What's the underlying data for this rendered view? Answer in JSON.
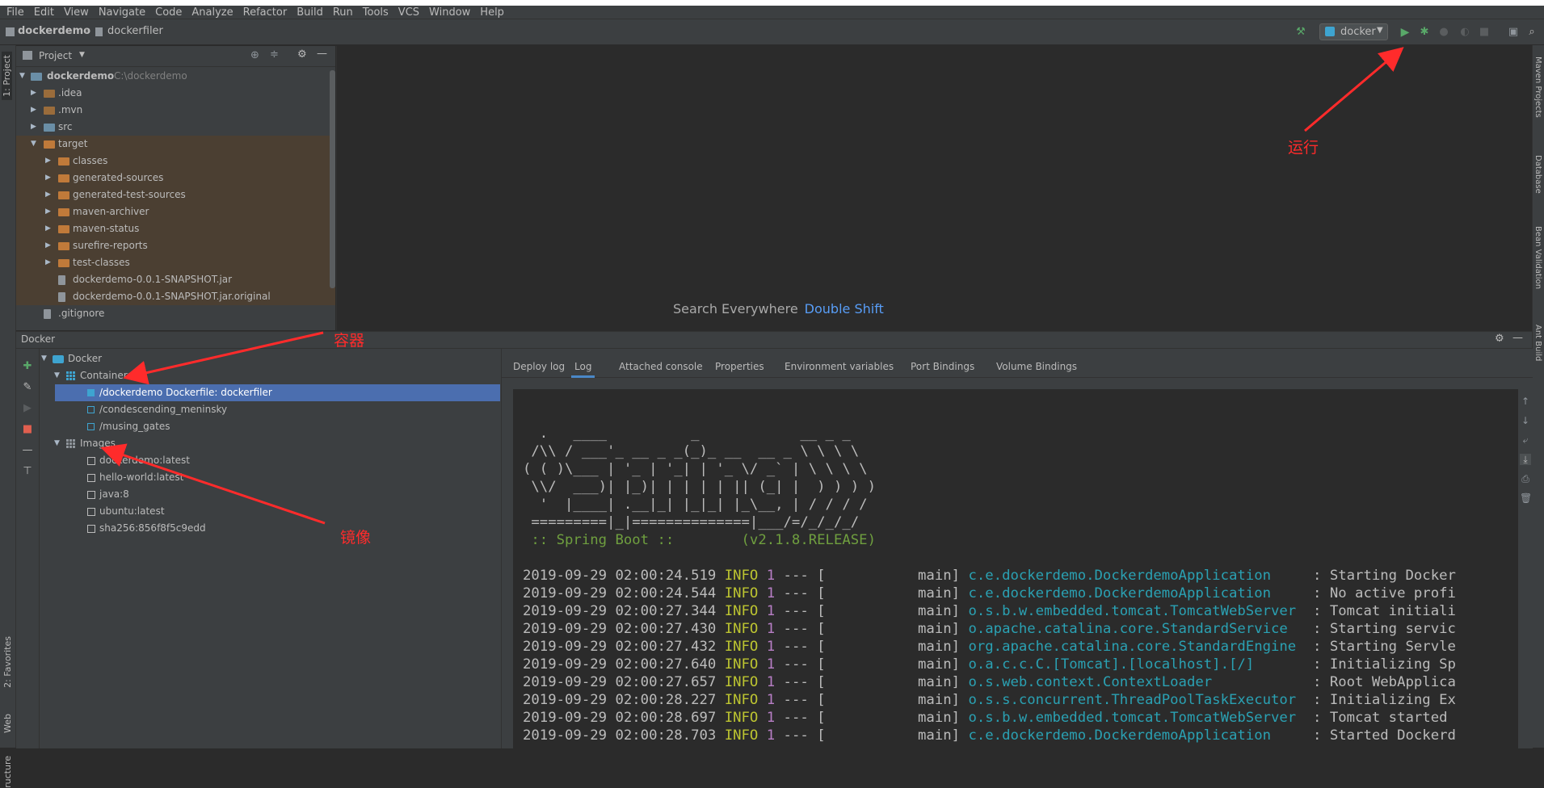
{
  "menu": [
    "File",
    "Edit",
    "View",
    "Navigate",
    "Code",
    "Analyze",
    "Refactor",
    "Build",
    "Run",
    "Tools",
    "VCS",
    "Window",
    "Help"
  ],
  "breadcrumb": {
    "project": "dockerdemo",
    "file": "dockerfiler"
  },
  "run_config": {
    "name": "docker"
  },
  "left_stripe": {
    "project": "1: Project",
    "favorites": "2: Favorites",
    "web": "Web",
    "structure": "ructure"
  },
  "right_stripe": {
    "maven": "Maven Projects",
    "database": "Database",
    "bean": "Bean Validation",
    "ant": "Ant Build"
  },
  "project_panel": {
    "title": "Project",
    "root": {
      "name": "dockerdemo",
      "path": "C:\\dockerdemo"
    },
    "items": [
      {
        "label": ".idea"
      },
      {
        "label": ".mvn"
      },
      {
        "label": "src"
      },
      {
        "label": "target"
      },
      {
        "label": "classes"
      },
      {
        "label": "generated-sources"
      },
      {
        "label": "generated-test-sources"
      },
      {
        "label": "maven-archiver"
      },
      {
        "label": "maven-status"
      },
      {
        "label": "surefire-reports"
      },
      {
        "label": "test-classes"
      },
      {
        "label": "dockerdemo-0.0.1-SNAPSHOT.jar"
      },
      {
        "label": "dockerdemo-0.0.1-SNAPSHOT.jar.original"
      },
      {
        "label": ".gitignore"
      }
    ]
  },
  "editor": {
    "hint_text": "Search Everywhere",
    "hint_key": "Double Shift"
  },
  "docker_panel": {
    "title": "Docker",
    "root": "Docker",
    "containers_label": "Containers",
    "containers": [
      "/dockerdemo Dockerfile: dockerfiler",
      "/condescending_meninsky",
      "/musing_gates"
    ],
    "images_label": "Images",
    "images": [
      "dockerdemo:latest",
      "hello-world:latest",
      "java:8",
      "ubuntu:latest",
      "sha256:856f8f5c9edd"
    ],
    "tabs": [
      "Deploy log",
      "Log",
      "Attached console",
      "Properties",
      "Environment variables",
      "Port Bindings",
      "Volume Bindings"
    ],
    "active_tab": "Log"
  },
  "console": {
    "banner": [
      "  .   ____          _            __ _ _",
      " /\\\\ / ___'_ __ _ _(_)_ __  __ _ \\ \\ \\ \\",
      "( ( )\\___ | '_ | '_| | '_ \\/ _` | \\ \\ \\ \\",
      " \\\\/  ___)| |_)| | | | | || (_| |  ) ) ) )",
      "  '  |____| .__|_| |_|_| |_\\__, | / / / /",
      " =========|_|==============|___/=/_/_/_/"
    ],
    "spring_line": " :: Spring Boot ::        (v2.1.8.RELEASE)",
    "log": [
      {
        "ts": "2019-09-29 02:00:24.519",
        "level": "INFO",
        "pid": "1",
        "sep": " --- [",
        "thread": "           main]",
        "logger": "c.e.dockerdemo.DockerdemoApplication    ",
        "msg": " : Starting Docker"
      },
      {
        "ts": "2019-09-29 02:00:24.544",
        "level": "INFO",
        "pid": "1",
        "sep": " --- [",
        "thread": "           main]",
        "logger": "c.e.dockerdemo.DockerdemoApplication    ",
        "msg": " : No active profi"
      },
      {
        "ts": "2019-09-29 02:00:27.344",
        "level": "INFO",
        "pid": "1",
        "sep": " --- [",
        "thread": "           main]",
        "logger": "o.s.b.w.embedded.tomcat.TomcatWebServer ",
        "msg": " : Tomcat initiali"
      },
      {
        "ts": "2019-09-29 02:00:27.430",
        "level": "INFO",
        "pid": "1",
        "sep": " --- [",
        "thread": "           main]",
        "logger": "o.apache.catalina.core.StandardService  ",
        "msg": " : Starting servic"
      },
      {
        "ts": "2019-09-29 02:00:27.432",
        "level": "INFO",
        "pid": "1",
        "sep": " --- [",
        "thread": "           main]",
        "logger": "org.apache.catalina.core.StandardEngine ",
        "msg": " : Starting Servle"
      },
      {
        "ts": "2019-09-29 02:00:27.640",
        "level": "INFO",
        "pid": "1",
        "sep": " --- [",
        "thread": "           main]",
        "logger": "o.a.c.c.C.[Tomcat].[localhost].[/]      ",
        "msg": " : Initializing Sp"
      },
      {
        "ts": "2019-09-29 02:00:27.657",
        "level": "INFO",
        "pid": "1",
        "sep": " --- [",
        "thread": "           main]",
        "logger": "o.s.web.context.ContextLoader           ",
        "msg": " : Root WebApplica"
      },
      {
        "ts": "2019-09-29 02:00:28.227",
        "level": "INFO",
        "pid": "1",
        "sep": " --- [",
        "thread": "           main]",
        "logger": "o.s.s.concurrent.ThreadPoolTaskExecutor ",
        "msg": " : Initializing Ex"
      },
      {
        "ts": "2019-09-29 02:00:28.697",
        "level": "INFO",
        "pid": "1",
        "sep": " --- [",
        "thread": "           main]",
        "logger": "o.s.b.w.embedded.tomcat.TomcatWebServer ",
        "msg": " : Tomcat started "
      },
      {
        "ts": "2019-09-29 02:00:28.703",
        "level": "INFO",
        "pid": "1",
        "sep": " --- [",
        "thread": "           main]",
        "logger": "c.e.dockerdemo.DockerdemoApplication    ",
        "msg": " : Started Dockerd"
      }
    ]
  },
  "annotations": {
    "run": "运行",
    "containers": "容器",
    "images": "镜像"
  },
  "colors": {
    "accent": "#4b6eaf",
    "annotation": "#ff2b2b",
    "run_green": "#59a869"
  }
}
